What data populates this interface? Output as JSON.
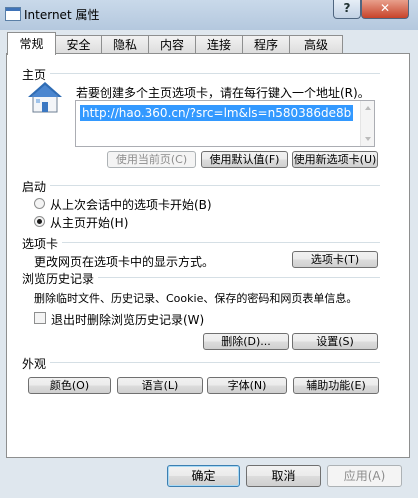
{
  "window": {
    "title": "Internet 属性",
    "help_label": "?",
    "close_label": "✕"
  },
  "tabs": [
    {
      "label": "常规",
      "active": true
    },
    {
      "label": "安全"
    },
    {
      "label": "隐私"
    },
    {
      "label": "内容"
    },
    {
      "label": "连接"
    },
    {
      "label": "程序"
    },
    {
      "label": "高级"
    }
  ],
  "home": {
    "section": "主页",
    "instruction": "若要创建多个主页选项卡，请在每行键入一个地址(R)。",
    "url": "http://hao.360.cn/?src=lm&ls=n580386de8b",
    "use_current": "使用当前页(C)",
    "use_default": "使用默认值(F)",
    "use_new_tab": "使用新选项卡(U)"
  },
  "startup": {
    "section": "启动",
    "option_last_session": "从上次会话中的选项卡开始(B)",
    "option_home": "从主页开始(H)",
    "selected": "option_home"
  },
  "tabs_section": {
    "section": "选项卡",
    "desc": "更改网页在选项卡中的显示方式。",
    "button": "选项卡(T)"
  },
  "history": {
    "section": "浏览历史记录",
    "desc": "删除临时文件、历史记录、Cookie、保存的密码和网页表单信息。",
    "checkbox_label": "退出时删除浏览历史记录(W)",
    "checked": false,
    "delete_button": "删除(D)...",
    "settings_button": "设置(S)"
  },
  "appearance": {
    "section": "外观",
    "colors": "颜色(O)",
    "languages": "语言(L)",
    "fonts": "字体(N)",
    "accessibility": "辅助功能(E)"
  },
  "footer": {
    "ok": "确定",
    "cancel": "取消",
    "apply": "应用(A)"
  }
}
